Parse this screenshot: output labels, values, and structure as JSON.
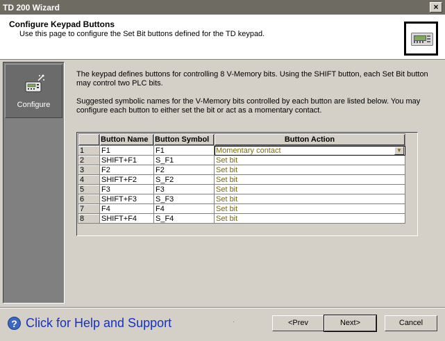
{
  "window": {
    "title": "TD 200 Wizard",
    "close_label": "×"
  },
  "header": {
    "title": "Configure Keypad Buttons",
    "subtitle": "Use this page to configure the Set Bit buttons defined for the TD keypad."
  },
  "nav": {
    "items": [
      {
        "label": "Configure",
        "icon": "td-device-icon"
      }
    ]
  },
  "body": {
    "para1": "The keypad defines buttons for controlling 8 V-Memory bits. Using the SHIFT button, each Set Bit button may control two PLC bits.",
    "para2": "Suggested symbolic names for the V-Memory bits controlled by each button are listed below. You may configure each button to either set the bit or act as a momentary contact."
  },
  "table": {
    "columns": [
      "Button Name",
      "Button Symbol",
      "Button Action"
    ],
    "rows": [
      {
        "num": "1",
        "name": "F1",
        "symbol": "F1",
        "action": "Momentary contact"
      },
      {
        "num": "2",
        "name": "SHIFT+F1",
        "symbol": "S_F1",
        "action": "Set bit"
      },
      {
        "num": "3",
        "name": "F2",
        "symbol": "F2",
        "action": "Set bit"
      },
      {
        "num": "4",
        "name": "SHIFT+F2",
        "symbol": "S_F2",
        "action": "Set bit"
      },
      {
        "num": "5",
        "name": "F3",
        "symbol": "F3",
        "action": "Set bit"
      },
      {
        "num": "6",
        "name": "SHIFT+F3",
        "symbol": "S_F3",
        "action": "Set bit"
      },
      {
        "num": "7",
        "name": "F4",
        "symbol": "F4",
        "action": "Set bit"
      },
      {
        "num": "8",
        "name": "SHIFT+F4",
        "symbol": "S_F4",
        "action": "Set bit"
      }
    ],
    "action_color": "#7a6a10"
  },
  "footer": {
    "help_icon": "?",
    "help_text": "Click for Help and Support",
    "prev_label": "<Prev",
    "next_label": "Next>",
    "cancel_label": "Cancel"
  },
  "colors": {
    "help_link": "#1431c8",
    "nav_bg": "#808080"
  }
}
